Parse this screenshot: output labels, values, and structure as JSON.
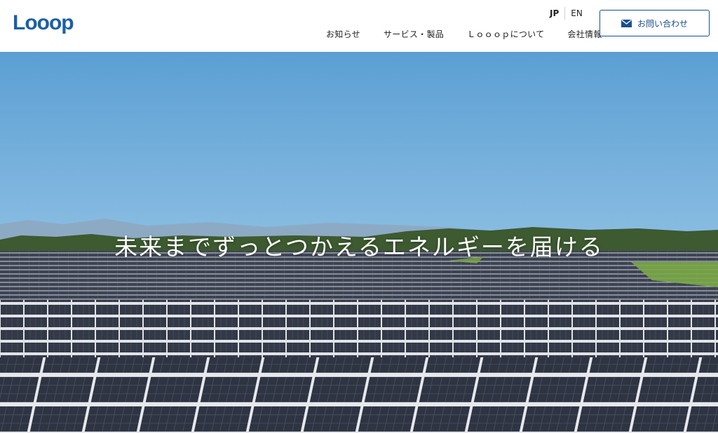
{
  "header": {
    "logo_text": "Looop",
    "brand_color": "#1a5fa8",
    "languages": [
      {
        "label": "JP",
        "active": true
      },
      {
        "label": "EN",
        "active": false
      }
    ],
    "nav": [
      "お知らせ",
      "サービス・製品",
      "Ｌｏｏｏｐについて",
      "会社情報"
    ],
    "contact_label": "お問い合わせ",
    "contact_icon": "envelope-icon"
  },
  "hero": {
    "tagline": "未来までずっとつかえるエネルギーを届ける"
  }
}
